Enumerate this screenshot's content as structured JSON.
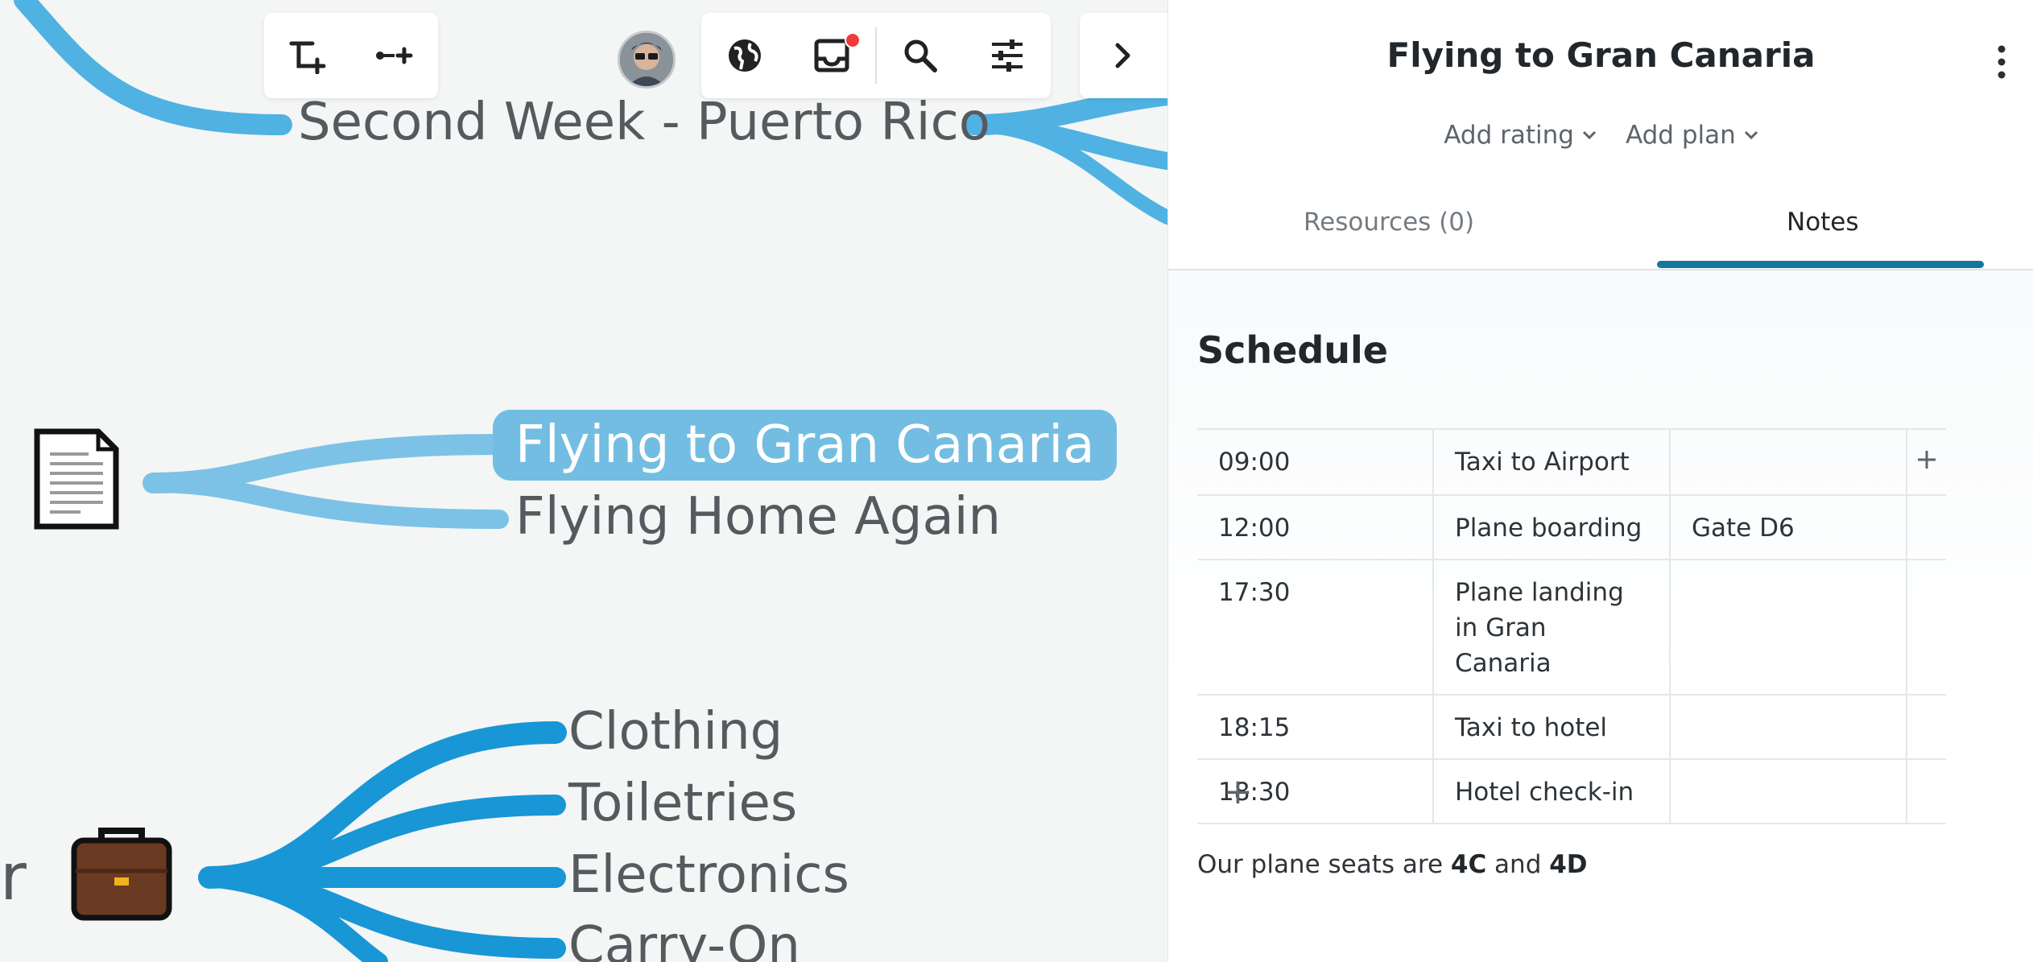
{
  "canvas": {
    "nodes": {
      "second_week": "Second Week - Puerto Rico",
      "flying_gc": "Flying to Gran Canaria",
      "flying_home": "Flying Home Again",
      "clothing": "Clothing",
      "toiletries": "Toiletries",
      "electronics": "Electronics",
      "carry_on": "Carry-On",
      "partial_r": "r"
    },
    "link_colors": {
      "top": "#4fb2e2",
      "middle": "#7cc2e6",
      "bottom": "#1896d6"
    },
    "icons": {
      "document_node": "document-icon",
      "briefcase_node": "briefcase-icon"
    }
  },
  "toolbar_left": {
    "icons": [
      "add-subtopic-icon",
      "add-connection-icon"
    ]
  },
  "toolbar_right": {
    "icons": [
      "globe-icon",
      "inbox-icon",
      "search-icon",
      "sliders-icon"
    ],
    "inbox_has_notification": true
  },
  "collapse_icon": "chevron-right-icon",
  "panel": {
    "title": "Flying to Gran Canaria",
    "menu_icon": "kebab-menu-icon",
    "add_rating": "Add rating",
    "add_plan": "Add plan",
    "tabs": [
      {
        "label": "Resources (0)",
        "active": false
      },
      {
        "label": "Notes",
        "active": true
      }
    ],
    "accent_color": "#15769e",
    "notes": {
      "heading": "Schedule",
      "rows": [
        {
          "time": "09:00",
          "activity": "Taxi to Airport",
          "detail": ""
        },
        {
          "time": "12:00",
          "activity": "Plane boarding",
          "detail": "Gate D6"
        },
        {
          "time": "17:30",
          "activity": "Plane landing in Gran Canaria",
          "detail": ""
        },
        {
          "time": "18:15",
          "activity": "Taxi to hotel",
          "detail": ""
        },
        {
          "time": "18:30",
          "activity": "Hotel check-in",
          "detail": ""
        }
      ],
      "add_column_symbol": "+",
      "add_row_symbol": "+",
      "note_prefix": "Our plane seats are ",
      "seat_1": "4C",
      "note_and": " and ",
      "seat_2": "4D"
    }
  }
}
